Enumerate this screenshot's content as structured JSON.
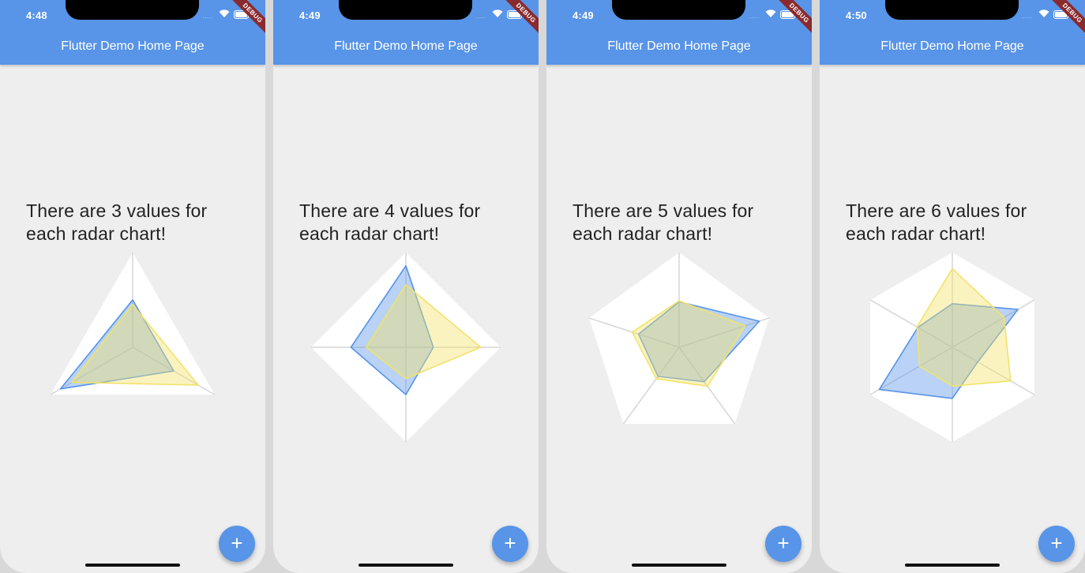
{
  "app": {
    "title": "Flutter Demo Home Page",
    "debug_banner": "DEBUG",
    "fab_label": "+",
    "signal_dots": ".....",
    "accent_color": "#5894e7"
  },
  "screens": [
    {
      "time": "4:48",
      "headline": "There are 3 values for each radar chart!"
    },
    {
      "time": "4:49",
      "headline": "There are 4 values for each radar chart!"
    },
    {
      "time": "4:49",
      "headline": "There are 5 values for each radar chart!"
    },
    {
      "time": "4:50",
      "headline": "There are 6 values for each radar chart!"
    }
  ],
  "chart_data": [
    {
      "type": "radar",
      "axes_count": 3,
      "series": [
        {
          "color": "#5894e7",
          "values": [
            0.5,
            0.5,
            0.88
          ]
        },
        {
          "color": "#f2e26a",
          "values": [
            0.45,
            0.8,
            0.74
          ]
        }
      ]
    },
    {
      "type": "radar",
      "axes_count": 4,
      "series": [
        {
          "color": "#5894e7",
          "values": [
            0.86,
            0.29,
            0.5,
            0.58
          ]
        },
        {
          "color": "#f2e26a",
          "values": [
            0.66,
            0.79,
            0.33,
            0.42
          ]
        }
      ]
    },
    {
      "type": "radar",
      "axes_count": 5,
      "series": [
        {
          "color": "#5894e7",
          "values": [
            0.48,
            0.89,
            0.45,
            0.38,
            0.45
          ]
        },
        {
          "color": "#f2e26a",
          "values": [
            0.49,
            0.73,
            0.51,
            0.41,
            0.52
          ]
        }
      ]
    },
    {
      "type": "radar",
      "axes_count": 6,
      "series": [
        {
          "color": "#5894e7",
          "values": [
            0.46,
            0.8,
            0.31,
            0.54,
            0.89,
            0.42
          ]
        },
        {
          "color": "#f2e26a",
          "values": [
            0.83,
            0.63,
            0.71,
            0.41,
            0.4,
            0.43
          ]
        }
      ]
    }
  ]
}
